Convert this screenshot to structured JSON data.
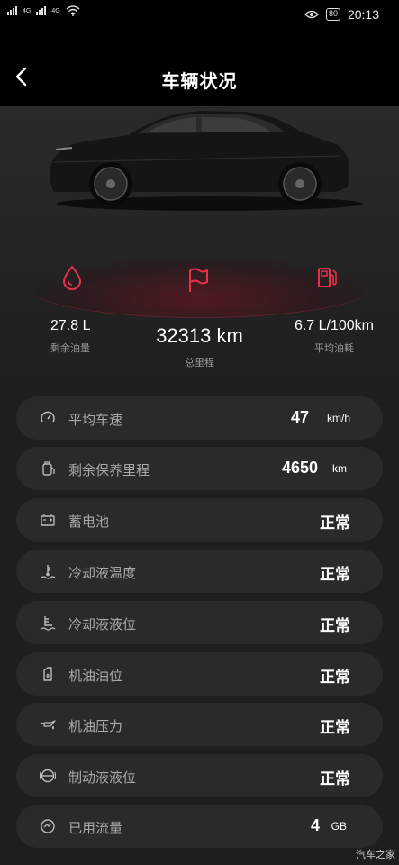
{
  "status_bar": {
    "network_label_1": "4G",
    "network_label_2": "4G",
    "battery": "80",
    "time": "20:13"
  },
  "header": {
    "title": "车辆状况"
  },
  "metrics": {
    "fuel": {
      "value": "27.8 L",
      "label": "剩余油量"
    },
    "odometer": {
      "value": "32313 km",
      "label": "总里程"
    },
    "consumption": {
      "value": "6.7 L/100km",
      "label": "平均油耗"
    }
  },
  "rows": [
    {
      "label": "平均车速",
      "value": "47",
      "unit": "km/h",
      "icon": "speedometer-icon"
    },
    {
      "label": "剩余保养里程",
      "value": "4650",
      "unit": "km",
      "icon": "maintenance-icon"
    },
    {
      "label": "蓄电池",
      "status": "正常",
      "icon": "battery-icon"
    },
    {
      "label": "冷却液温度",
      "status": "正常",
      "icon": "coolant-temp-icon"
    },
    {
      "label": "冷却液液位",
      "status": "正常",
      "icon": "coolant-level-icon"
    },
    {
      "label": "机油油位",
      "status": "正常",
      "icon": "oil-level-icon"
    },
    {
      "label": "机油压力",
      "status": "正常",
      "icon": "oil-pressure-icon"
    },
    {
      "label": "制动液液位",
      "status": "正常",
      "icon": "brake-fluid-icon"
    },
    {
      "label": "已用流量",
      "value": "4",
      "unit": "GB",
      "icon": "data-usage-icon"
    }
  ],
  "watermark": "汽车之家",
  "colors": {
    "accent": "#e8304a",
    "background": "#1e1e1f",
    "row_bg": "#2a2a2b"
  }
}
